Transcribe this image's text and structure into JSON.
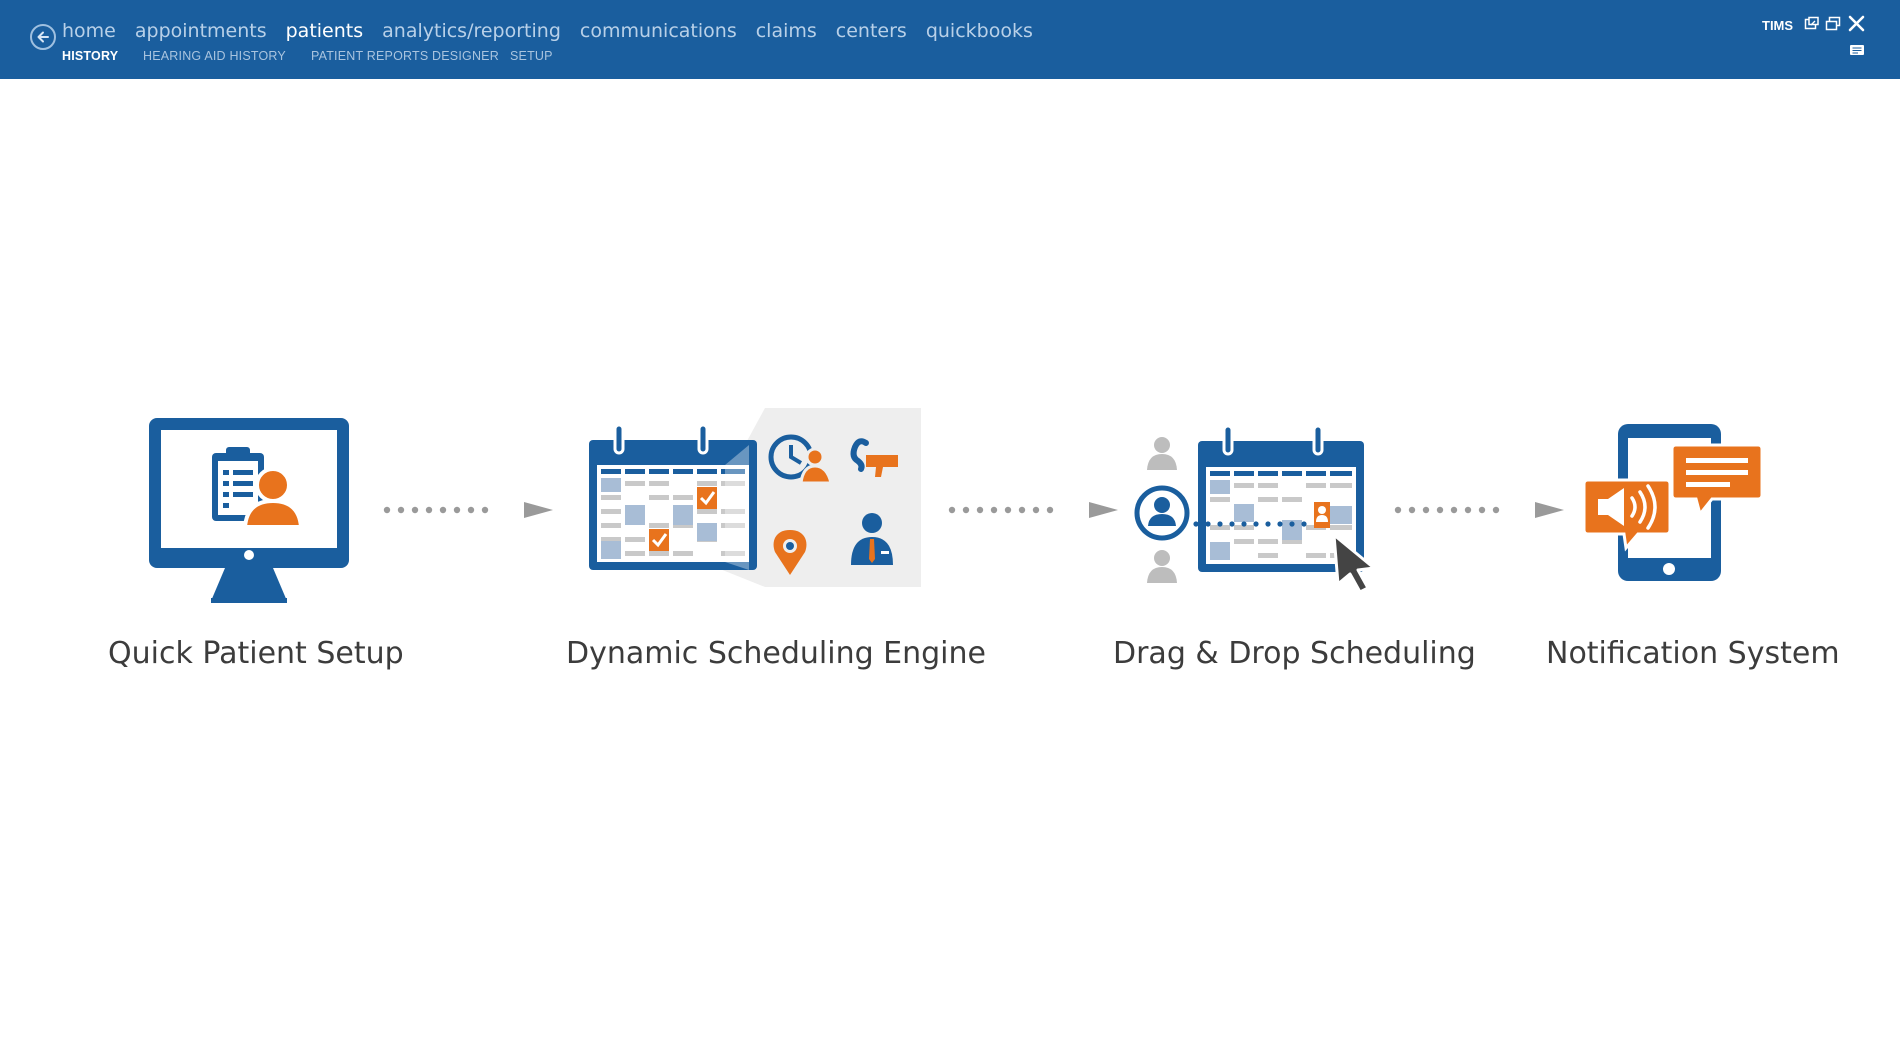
{
  "nav": {
    "main": [
      "home",
      "appointments",
      "patients",
      "analytics/reporting",
      "communications",
      "claims",
      "centers",
      "quickbooks"
    ],
    "active_main": "patients",
    "sub": [
      "HISTORY",
      "HEARING AID HISTORY",
      "PATIENT REPORTS DESIGNER",
      "SETUP"
    ],
    "active_sub": "HISTORY"
  },
  "window": {
    "title": "TIMS"
  },
  "features": [
    {
      "label": "Quick Patient Setup",
      "icon": "monitor-patient-icon"
    },
    {
      "label": "Dynamic Scheduling Engine",
      "icon": "calendar-engine-icon"
    },
    {
      "label": "Drag & Drop Scheduling",
      "icon": "drag-drop-calendar-icon"
    },
    {
      "label": "Notification System",
      "icon": "tablet-notification-icon"
    }
  ],
  "colors": {
    "header": "#1a5e9e",
    "brand_blue": "#1a5e9e",
    "accent_orange": "#e8731d",
    "arrow_gray": "#9a9a9a"
  }
}
